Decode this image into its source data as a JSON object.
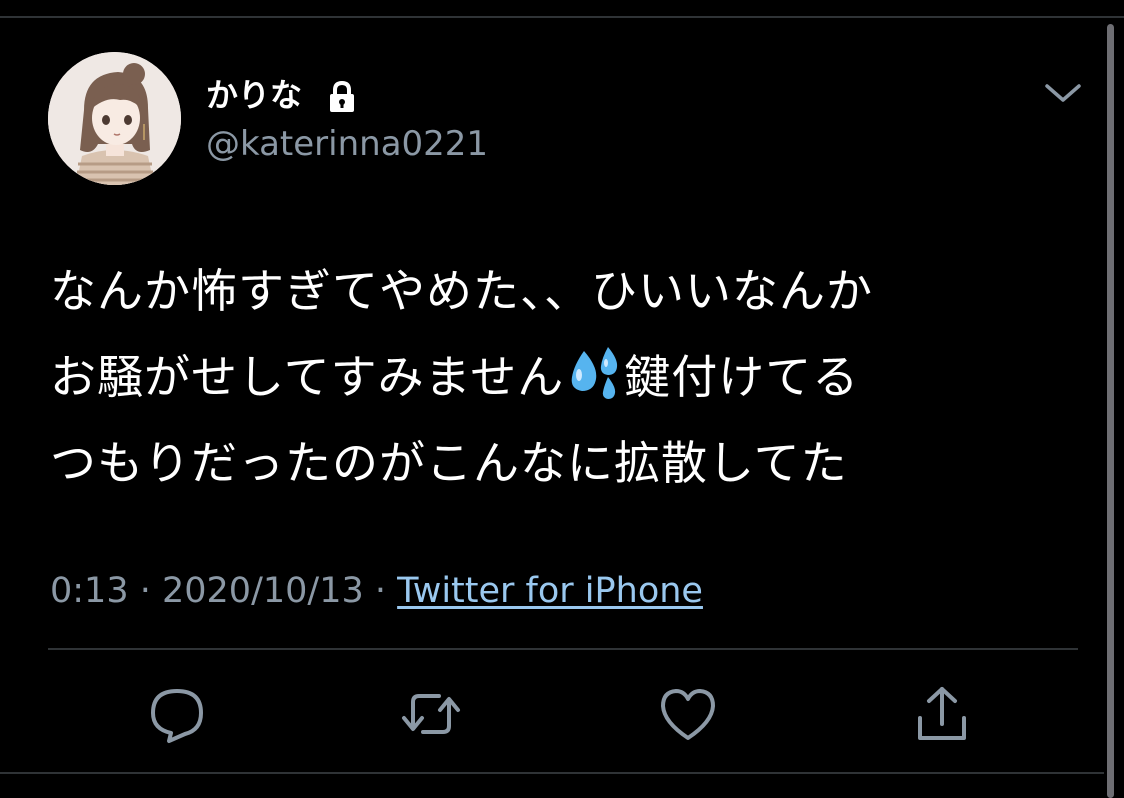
{
  "user": {
    "display_name": "かりな",
    "handle": "@katerinna0221",
    "protected": true
  },
  "tweet": {
    "lines": [
      "なんか怖すぎてやめた、、ひいいなんか",
      "お騒がせしてすみません",
      "鍵付けてる",
      "つもりだったのがこんなに拡散してた"
    ],
    "emoji": "sweat-droplets"
  },
  "meta": {
    "time": "0:13",
    "separator1": " · ",
    "date": "2020/10/13",
    "separator2": " · ",
    "source": "Twitter for iPhone"
  },
  "actions": [
    "reply-icon",
    "retweet-icon",
    "like-icon",
    "share-icon"
  ],
  "colors": {
    "background": "#000000",
    "text": "#ffffff",
    "secondary": "#8b98a5",
    "link": "#9ac8ef",
    "divider": "#2f3336",
    "emoji_blue": "#56b4ef"
  }
}
